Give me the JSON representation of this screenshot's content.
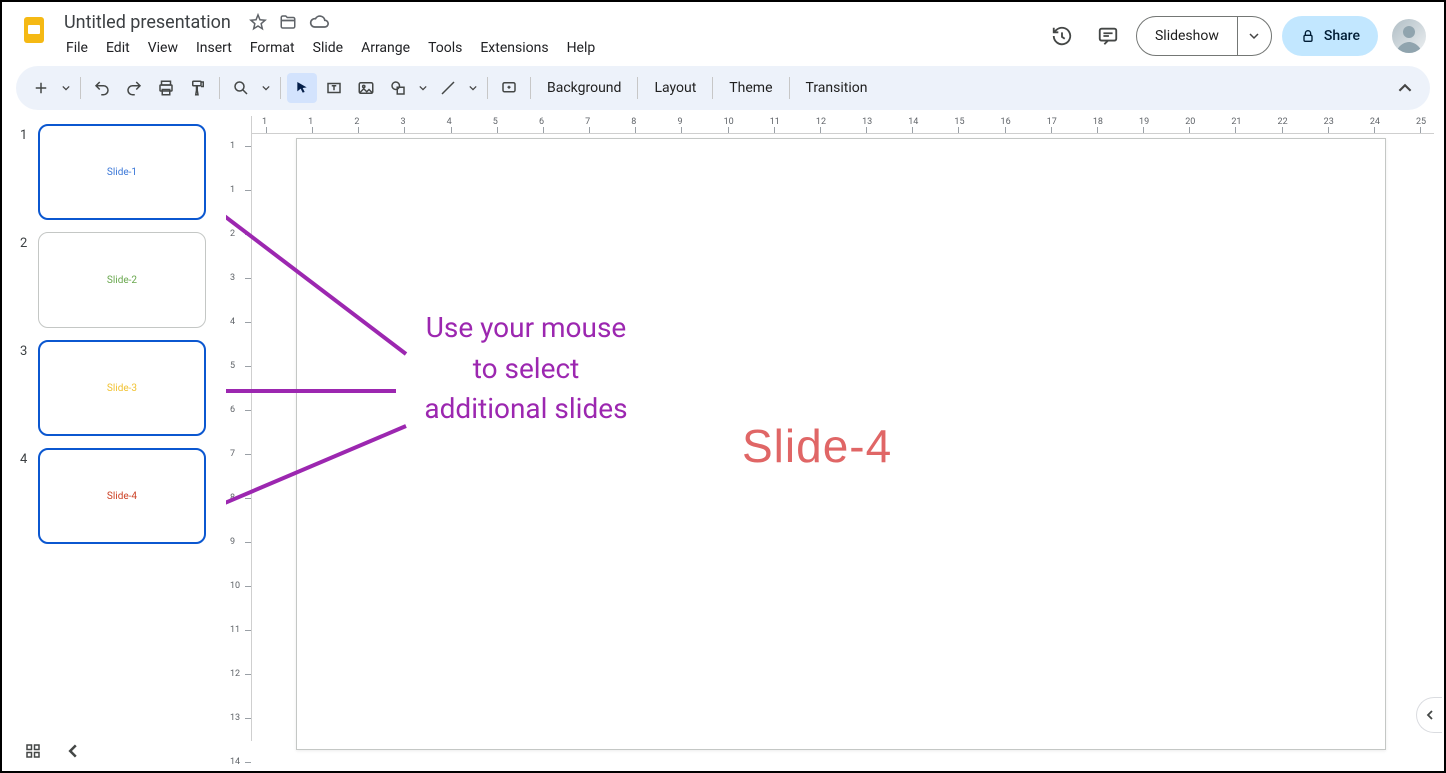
{
  "doc": {
    "title": "Untitled presentation"
  },
  "menus": [
    "File",
    "Edit",
    "View",
    "Insert",
    "Format",
    "Slide",
    "Arrange",
    "Tools",
    "Extensions",
    "Help"
  ],
  "header": {
    "slideshow": "Slideshow",
    "share": "Share"
  },
  "toolbar": {
    "background": "Background",
    "layout": "Layout",
    "theme": "Theme",
    "transition": "Transition"
  },
  "slides": [
    {
      "number": "1",
      "label": "Slide-1",
      "selected": true,
      "color": "#3c78d8"
    },
    {
      "number": "2",
      "label": "Slide-2",
      "selected": false,
      "color": "#6aa84f"
    },
    {
      "number": "3",
      "label": "Slide-3",
      "selected": true,
      "color": "#f1c232"
    },
    {
      "number": "4",
      "label": "Slide-4",
      "selected": true,
      "color": "#cc4125"
    }
  ],
  "canvas": {
    "mainText": "Slide-4"
  },
  "annotation": {
    "line1": "Use your mouse",
    "line2": "to select",
    "line3": "additional slides"
  },
  "ruler": {
    "hLabels": [
      "1",
      "1",
      "2",
      "3",
      "4",
      "5",
      "6",
      "7",
      "8",
      "9",
      "10",
      "11",
      "12",
      "13",
      "14",
      "15",
      "16",
      "17",
      "18",
      "19",
      "20",
      "21",
      "22",
      "23",
      "24",
      "25"
    ],
    "vLabels": [
      "1",
      "1",
      "2",
      "3",
      "4",
      "5",
      "6",
      "7",
      "8",
      "9",
      "10",
      "11",
      "12",
      "13",
      "14"
    ]
  }
}
